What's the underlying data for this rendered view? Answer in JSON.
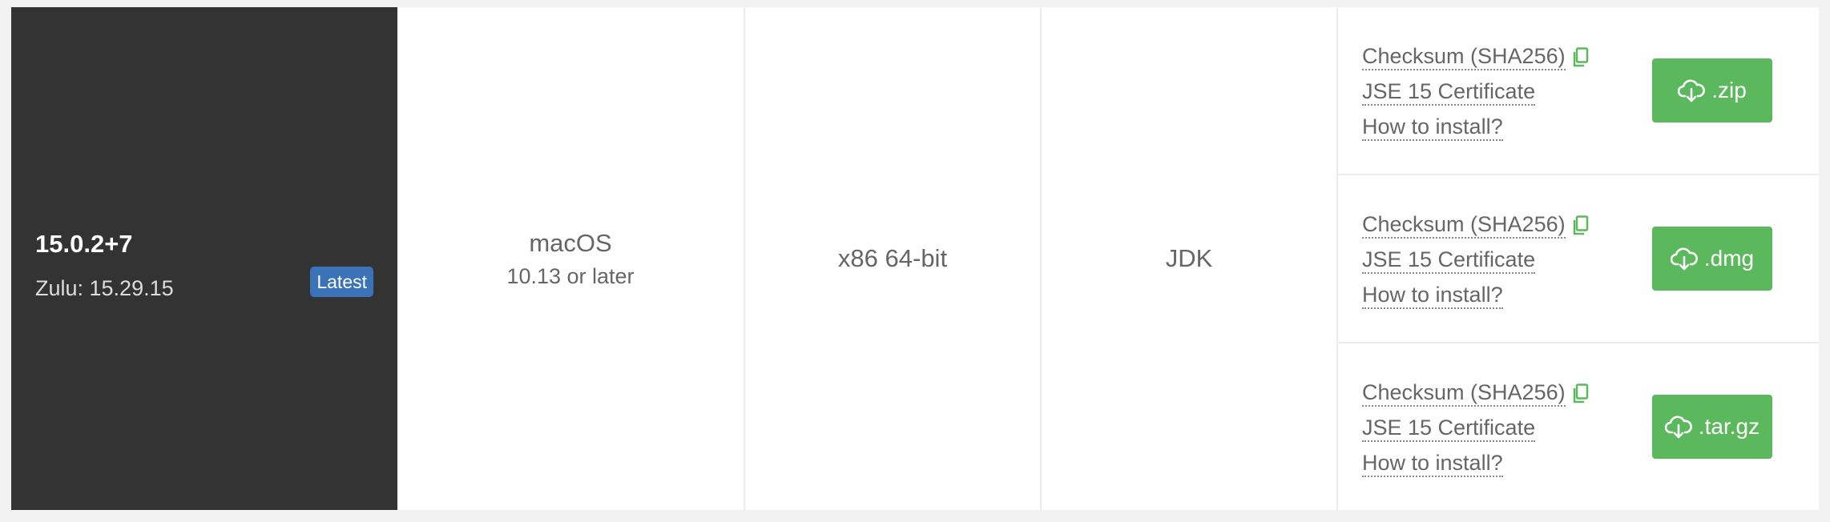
{
  "version": {
    "title": "15.0.2+7",
    "zulu": "Zulu: 15.29.15",
    "badge": "Latest"
  },
  "os": {
    "name": "macOS",
    "requirement": "10.13 or later"
  },
  "architecture": "x86 64-bit",
  "package_type": "JDK",
  "downloads": [
    {
      "checksum_label": "Checksum (SHA256)",
      "certificate_label": "JSE 15 Certificate",
      "install_label": "How to install?",
      "button_label": ".zip"
    },
    {
      "checksum_label": "Checksum (SHA256)",
      "certificate_label": "JSE 15 Certificate",
      "install_label": "How to install?",
      "button_label": ".dmg"
    },
    {
      "checksum_label": "Checksum (SHA256)",
      "certificate_label": "JSE 15 Certificate",
      "install_label": "How to install?",
      "button_label": ".tar.gz"
    }
  ],
  "colors": {
    "version_bg": "#333333",
    "badge_bg": "#3b73b9",
    "button_bg": "#5cb85c",
    "copy_icon": "#5cb85c"
  },
  "icons": {
    "copy": "copy-icon",
    "download": "cloud-download-icon"
  }
}
